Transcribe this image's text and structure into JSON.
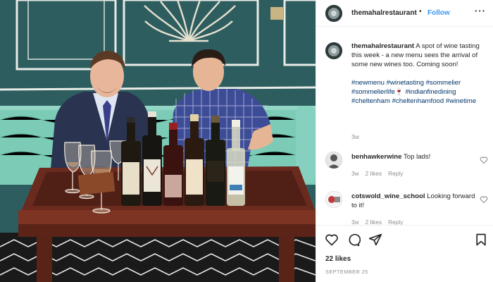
{
  "post": {
    "username": "themahalrestaurant",
    "separator": "•",
    "follow_label": "Follow",
    "more_label": "···"
  },
  "caption": {
    "username": "themahalrestaurant",
    "text": "A spot of wine tasting this week - a new menu sees the arrival of some new wines too. Coming soon!",
    "hashtags": "#newmenu #winetasting #sommelier #sommelierlife🍷 #indianfinedining #cheltenham #cheltenhamfood #winetime",
    "time": "3w"
  },
  "comments": [
    {
      "username": "benhawkerwine",
      "text": "Top lads!",
      "time": "3w",
      "likes": "2 likes",
      "reply": "Reply"
    },
    {
      "username": "cotswold_wine_school",
      "text": "Looking forward to it!",
      "time": "3w",
      "likes": "2 likes",
      "reply": "Reply"
    }
  ],
  "actions": {
    "likes_count": "22 likes",
    "date": "SEPTEMBER 25"
  },
  "photo": {
    "bottle_labels": [
      "",
      "",
      "",
      "",
      "",
      "",
      ""
    ]
  }
}
